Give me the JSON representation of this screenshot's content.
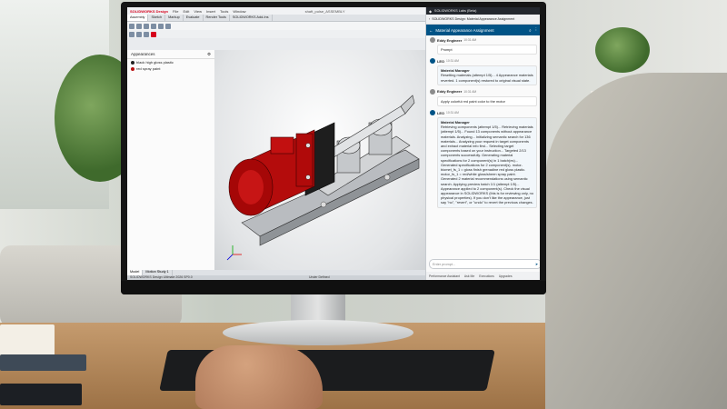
{
  "solidworks": {
    "logo": "SOLIDWORKS Design",
    "menu": [
      "File",
      "Edit",
      "View",
      "Insert",
      "Tools",
      "Window"
    ],
    "doc_title": "shaft_pulse_ASSEMBLY",
    "tabs": [
      "Assembly",
      "Sketch",
      "Markup",
      "Evaluate",
      "Render Tools",
      "SOLIDWORKS Add-Ins"
    ],
    "panel_title": "Appearances",
    "tree": [
      {
        "label": "black high gloss plastic",
        "color": "#222222"
      },
      {
        "label": "red spray paint",
        "color": "#b80f0f"
      }
    ],
    "bottom_tabs": [
      "Model",
      "Motion Study 1"
    ],
    "status": "SOLIDWORKS Design Ultimate 2026 SP0.0",
    "status_right": "Under Defined"
  },
  "chat": {
    "app_title": "SOLIDWORKS Labs (Beta)",
    "sub_title": "SOLIDWORKS Design: Material Appearance Assignment",
    "header_title": "Material Appearance Assignment",
    "messages": [
      {
        "author": "Eddy Engineer",
        "time": "10:31 AM",
        "avatar": "#8b8b8b",
        "text": "Prompt"
      },
      {
        "author": "LEO",
        "time": "10:31 AM",
        "avatar": "#005386",
        "sub": "Material Manager",
        "text": "Resetting materials (attempt 1/5)... 4 Appearance materials reverted. 1 component(s) restored to original visual state."
      },
      {
        "author": "Eddy Engineer",
        "time": "10:31 AM",
        "avatar": "#8b8b8b",
        "text": "Apply colorful red paint color to the motor"
      },
      {
        "author": "LEO",
        "time": "10:31 AM",
        "avatar": "#005386",
        "sub": "Material Manager",
        "text": "Retrieving components (attempt 1/5)... Retrieving materials (attempt 1/5)... Found 13 components without appearance materials. Analyzing... Initializing semantic search for 136 materials... Analyzing your request in target components and extract material info first... Selecting target components based on your instruction... Targeted 2/13 components successfully. Generating material specifications for 2 component(s) in 1 batch(es)... Generated specifications for 2 component(s). motor-biomet_fs_1 = gloss finish grenadine red gloss plastic. motor_fs_1 = red/white gloss/sheen spray paint. Generated 2 material recommendations using semantic search. Applying preview batch 1/1 (attempt 1/5)... Appearance applied to 2 component(s). Check the visual appearance in SOLIDWORKS (this is for reviewing only, no physical properties). If you don't like the appearance, just say \"no\", \"revert\", or \"undo\" to revert the previous changes."
      }
    ],
    "input_placeholder": "Enter prompt...",
    "footer": [
      "Performance Assistant",
      "Ask Me",
      "Executions",
      "Upgrades"
    ]
  }
}
